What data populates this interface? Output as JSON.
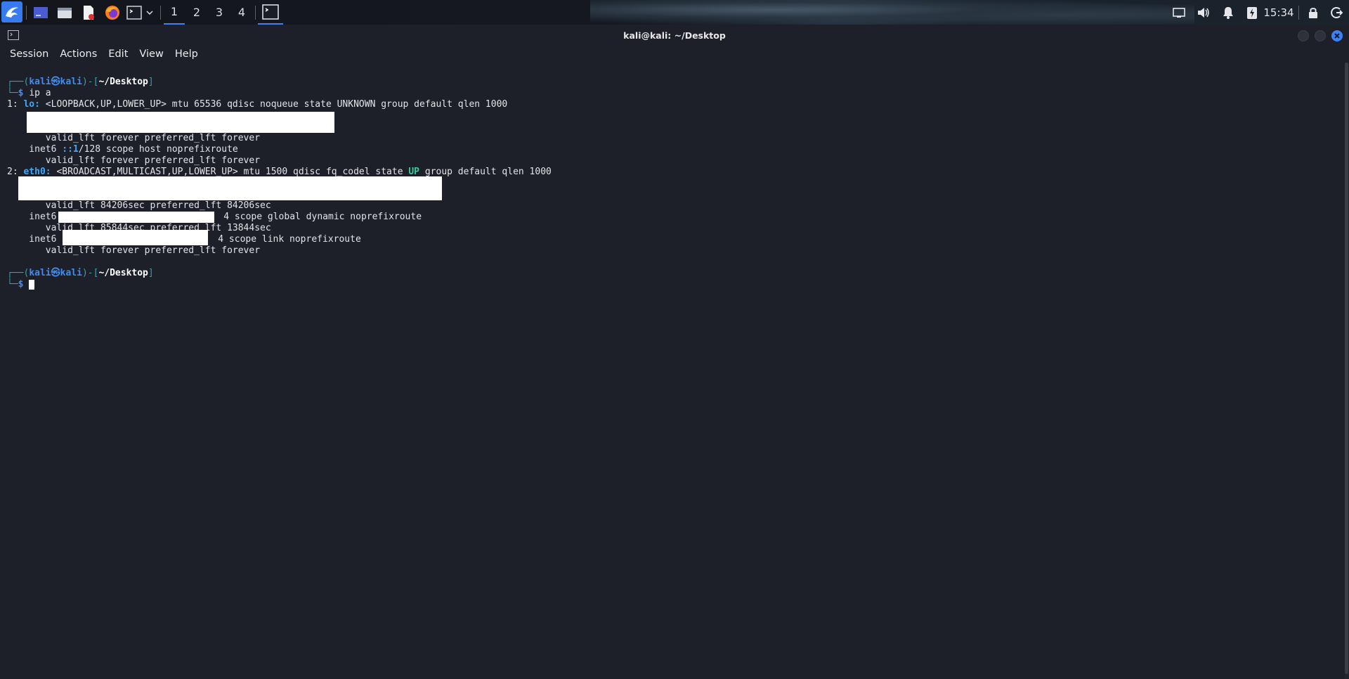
{
  "panel": {
    "workspaces": [
      "1",
      "2",
      "3",
      "4"
    ],
    "active_workspace": "1",
    "clock": "15:34",
    "icons": [
      "kali-menu-icon",
      "desktop-icon",
      "file-manager-icon",
      "text-editor-icon",
      "firefox-icon",
      "terminal-icon",
      "chevron-down-icon"
    ]
  },
  "window": {
    "title": "kali@kali: ~/Desktop"
  },
  "menubar": {
    "items": [
      "Session",
      "Actions",
      "Edit",
      "View",
      "Help"
    ]
  },
  "terminal": {
    "prompt_user": "kali",
    "prompt_at": "㉿",
    "prompt_host": "kali",
    "prompt_path": "~/Desktop",
    "command": "ip a",
    "lines": {
      "l1_num": "1: ",
      "l1_iface": "lo:",
      "l1_rest": " <LOOPBACK,UP,LOWER_UP> mtu 65536 qdisc noqueue state UNKNOWN group default qlen 1000",
      "l3": "       valid_lft forever preferred_lft forever",
      "l4_a": "    inet6 ",
      "l4_addr": "::1",
      "l4_b": "/128 scope host noprefixroute",
      "l5": "       valid_lft forever preferred_lft forever",
      "l6_num": "2: ",
      "l6_iface": "eth0:",
      "l6_a": " <BROADCAST,MULTICAST,UP,LOWER_UP> mtu 1500 qdisc fq_codel state ",
      "l6_state": "UP",
      "l6_b": " group default qlen 1000",
      "l9": "       valid_lft 84206sec preferred_lft 84206sec",
      "l10_a": "    inet6 ",
      "l10_b": "4 scope global dynamic noprefixroute",
      "l11": "       valid_lft 85844sec preferred_lft 13844sec",
      "l12_a": "    inet6 ",
      "l12_b": "4 scope link noprefixroute",
      "l13": "       valid_lft forever preferred_lft forever"
    }
  },
  "colors": {
    "background": "#1e2029",
    "accent": "#367bf0",
    "prompt_frame": "#2aa3b4",
    "close_button": "#3b82f6"
  }
}
